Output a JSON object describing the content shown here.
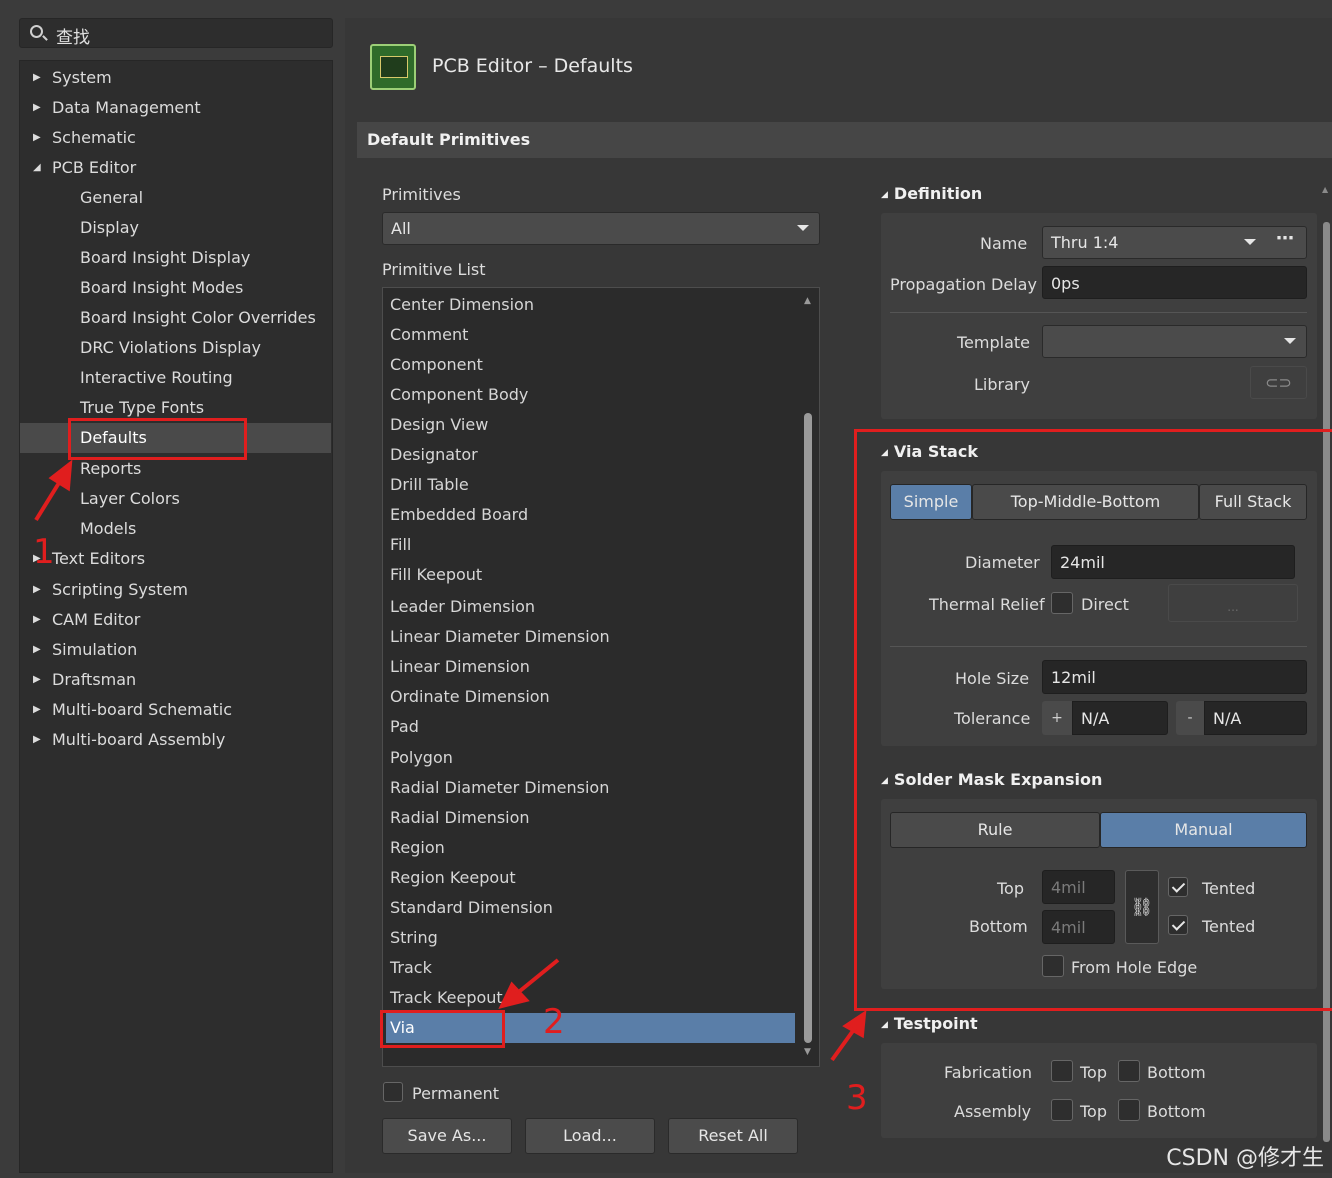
{
  "search": {
    "placeholder": "查找"
  },
  "tree": {
    "top_items": [
      {
        "label": "System"
      },
      {
        "label": "Data Management"
      },
      {
        "label": "Schematic"
      },
      {
        "label": "PCB Editor"
      }
    ],
    "pcb_children": [
      {
        "label": "General"
      },
      {
        "label": "Display"
      },
      {
        "label": "Board Insight Display"
      },
      {
        "label": "Board Insight Modes"
      },
      {
        "label": "Board Insight Color Overrides"
      },
      {
        "label": "DRC Violations Display"
      },
      {
        "label": "Interactive Routing"
      },
      {
        "label": "True Type Fonts"
      },
      {
        "label": "Defaults"
      },
      {
        "label": "Reports"
      },
      {
        "label": "Layer Colors"
      },
      {
        "label": "Models"
      }
    ],
    "bottom_items": [
      {
        "label": "Text Editors"
      },
      {
        "label": "Scripting System"
      },
      {
        "label": "CAM Editor"
      },
      {
        "label": "Simulation"
      },
      {
        "label": "Draftsman"
      },
      {
        "label": "Multi-board Schematic"
      },
      {
        "label": "Multi-board Assembly"
      }
    ]
  },
  "header": {
    "title": "PCB Editor – Defaults",
    "section": "Default Primitives",
    "logo_icon": "pcb-board-icon"
  },
  "primitives": {
    "label": "Primitives",
    "filter_value": "All",
    "list_label": "Primitive List",
    "items": [
      "Center Dimension",
      "Comment",
      "Component",
      "Component Body",
      "Design View",
      "Designator",
      "Drill Table",
      "Embedded Board",
      "Fill",
      "Fill Keepout",
      "Leader Dimension",
      "Linear Diameter Dimension",
      "Linear Dimension",
      "Ordinate Dimension",
      "Pad",
      "Polygon",
      "Radial Diameter Dimension",
      "Radial Dimension",
      "Region",
      "Region Keepout",
      "Standard Dimension",
      "String",
      "Track",
      "Track Keepout",
      "Via"
    ],
    "selected": "Via",
    "permanent_label": "Permanent",
    "save_as": "Save As...",
    "load": "Load...",
    "reset_all": "Reset All"
  },
  "definition": {
    "title": "Definition",
    "name_label": "Name",
    "name_value": "Thru 1:4",
    "prop_label": "Propagation Delay",
    "prop_value": "0ps",
    "template_label": "Template",
    "template_value": "",
    "library_label": "Library"
  },
  "via_stack": {
    "title": "Via Stack",
    "tabs": [
      "Simple",
      "Top-Middle-Bottom",
      "Full Stack"
    ],
    "active_tab": "Simple",
    "diameter_label": "Diameter",
    "diameter_value": "24mil",
    "thermal_label": "Thermal Relief",
    "direct_label": "Direct",
    "dots": "...",
    "hole_label": "Hole Size",
    "hole_value": "12mil",
    "tol_label": "Tolerance",
    "tol_plus": "+",
    "tol_plus_value": "N/A",
    "tol_minus": "-",
    "tol_minus_value": "N/A"
  },
  "solder_mask": {
    "title": "Solder Mask Expansion",
    "tabs": [
      "Rule",
      "Manual"
    ],
    "active_tab": "Manual",
    "top_label": "Top",
    "top_value": "4mil",
    "bottom_label": "Bottom",
    "bottom_value": "4mil",
    "tented_label": "Tented",
    "from_hole_label": "From Hole Edge"
  },
  "testpoint": {
    "title": "Testpoint",
    "fab_label": "Fabrication",
    "asm_label": "Assembly",
    "top_label": "Top",
    "bottom_label": "Bottom"
  },
  "annotations": {
    "n1": "1",
    "n2": "2",
    "n3": "3",
    "accent": "#e01e1e"
  },
  "watermark": "CSDN @修才生"
}
